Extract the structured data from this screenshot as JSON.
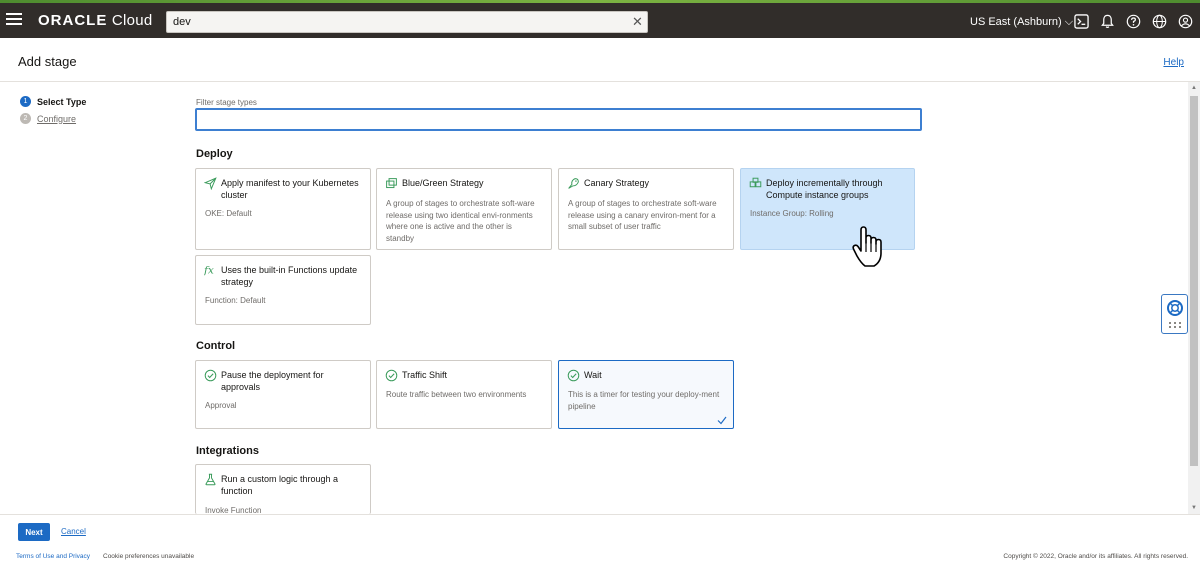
{
  "header": {
    "brand_bold": "ORACLE",
    "brand_light": "Cloud",
    "search_value": "dev",
    "region": "US East (Ashburn)",
    "icons": [
      "menu-icon",
      "close-icon",
      "cloud-shell-icon",
      "bell-icon",
      "help-icon",
      "globe-icon",
      "user-icon"
    ]
  },
  "page": {
    "title": "Add stage",
    "help": "Help"
  },
  "steps": [
    {
      "num": "1",
      "label": "Select Type"
    },
    {
      "num": "2",
      "label": "Configure"
    }
  ],
  "filter": {
    "label": "Filter stage types",
    "value": ""
  },
  "sections": {
    "deploy": "Deploy",
    "control": "Control",
    "integrations": "Integrations"
  },
  "cards": {
    "manifest": {
      "title": "Apply manifest to your Kubernetes cluster",
      "desc": "OKE: Default",
      "icon": "send-icon"
    },
    "bluegreen": {
      "title": "Blue/Green Strategy",
      "desc": "A group of stages to orchestrate soft-ware release using two identical envi-ronments where one is active and the other is standby",
      "icon": "blue-green-icon"
    },
    "canary": {
      "title": "Canary Strategy",
      "desc": "A group of stages to orchestrate soft-ware release using a canary environ-ment for a small subset of user traffic",
      "icon": "canary-icon"
    },
    "instance": {
      "title": "Deploy incrementally through Compute instance groups",
      "desc": "Instance Group: Rolling",
      "icon": "instance-group-icon"
    },
    "functions": {
      "title": "Uses the built-in Functions update strategy",
      "desc": "Function: Default",
      "icon": "function-icon"
    },
    "approval": {
      "title": "Pause the deployment for approvals",
      "desc": "Approval",
      "icon": "check-circle-icon"
    },
    "traffic": {
      "title": "Traffic Shift",
      "desc": "Route traffic between two environments",
      "icon": "check-circle-icon"
    },
    "wait": {
      "title": "Wait",
      "desc": "This is a timer for testing your deploy-ment pipeline",
      "icon": "check-circle-icon"
    },
    "custom": {
      "title": "Run a custom logic through a function",
      "desc": "Invoke Function",
      "icon": "flask-icon"
    }
  },
  "footer": {
    "next": "Next",
    "cancel": "Cancel",
    "terms": "Terms of Use and Privacy",
    "cookies": "Cookie preferences unavailable",
    "copyright": "Copyright © 2022, Oracle and/or its affiliates. All rights reserved."
  },
  "colors": {
    "topbar": "#312d2a",
    "accent": "#1c6ac4",
    "hover_card": "#cfe6fb",
    "icon_green": "#3a9b5b"
  }
}
